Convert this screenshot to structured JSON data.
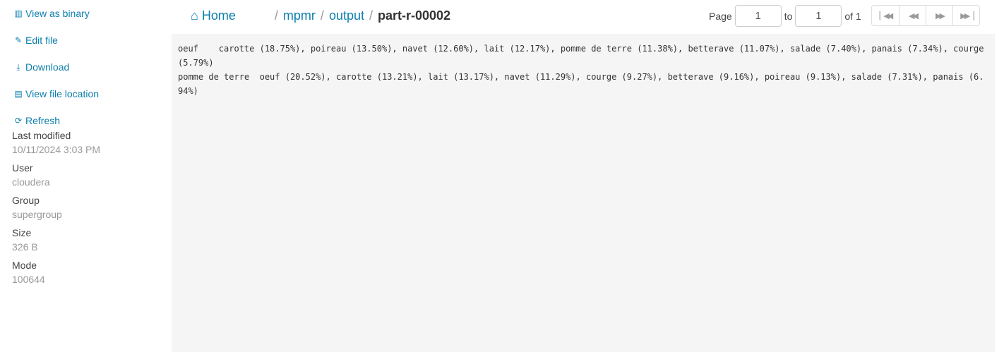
{
  "sidebar": {
    "actions": [
      {
        "label": "View as binary",
        "icon": "barcode-icon"
      },
      {
        "label": "Edit file",
        "icon": "pencil-icon"
      },
      {
        "label": "Download",
        "icon": "download-icon"
      },
      {
        "label": "View file location",
        "icon": "file-icon"
      },
      {
        "label": "Refresh",
        "icon": "refresh-icon"
      }
    ],
    "meta": [
      {
        "label": "Last modified",
        "value": "10/11/2024 3:03 PM"
      },
      {
        "label": "User",
        "value": "cloudera"
      },
      {
        "label": "Group",
        "value": "supergroup"
      },
      {
        "label": "Size",
        "value": "326 B"
      },
      {
        "label": "Mode",
        "value": "100644"
      }
    ]
  },
  "breadcrumb": {
    "home": "Home",
    "items": [
      "mpmr",
      "output"
    ],
    "current": "part-r-00002",
    "separator": "/"
  },
  "pager": {
    "page_label": "Page",
    "from": "1",
    "to_label": "to",
    "to": "1",
    "of_label": "of 1"
  },
  "file_content": "oeuf\tcarotte (18.75%), poireau (13.50%), navet (12.60%), lait (12.17%), pomme de terre (11.38%), betterave (11.07%), salade (7.40%), panais (7.34%), courge (5.79%)\npomme de terre\toeuf (20.52%), carotte (13.21%), lait (13.17%), navet (11.29%), courge (9.27%), betterave (9.16%), poireau (9.13%), salade (7.31%), panais (6.94%)"
}
